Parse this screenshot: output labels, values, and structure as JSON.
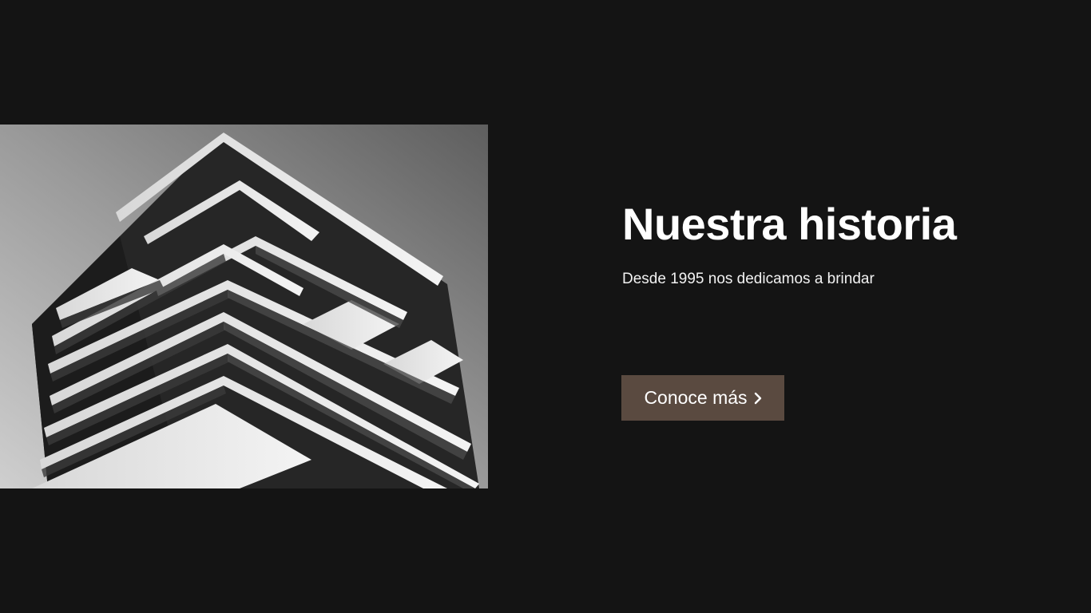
{
  "hero": {
    "image_alt": "building-photo",
    "title": "Nuestra historia",
    "subtitle": "Desde 1995 nos dedicamos a brindar",
    "cta_label": "Conoce más",
    "cta_icon": "chevron-right-icon"
  },
  "colors": {
    "background": "#141414",
    "button": "#5a4a40",
    "text": "#ffffff"
  }
}
